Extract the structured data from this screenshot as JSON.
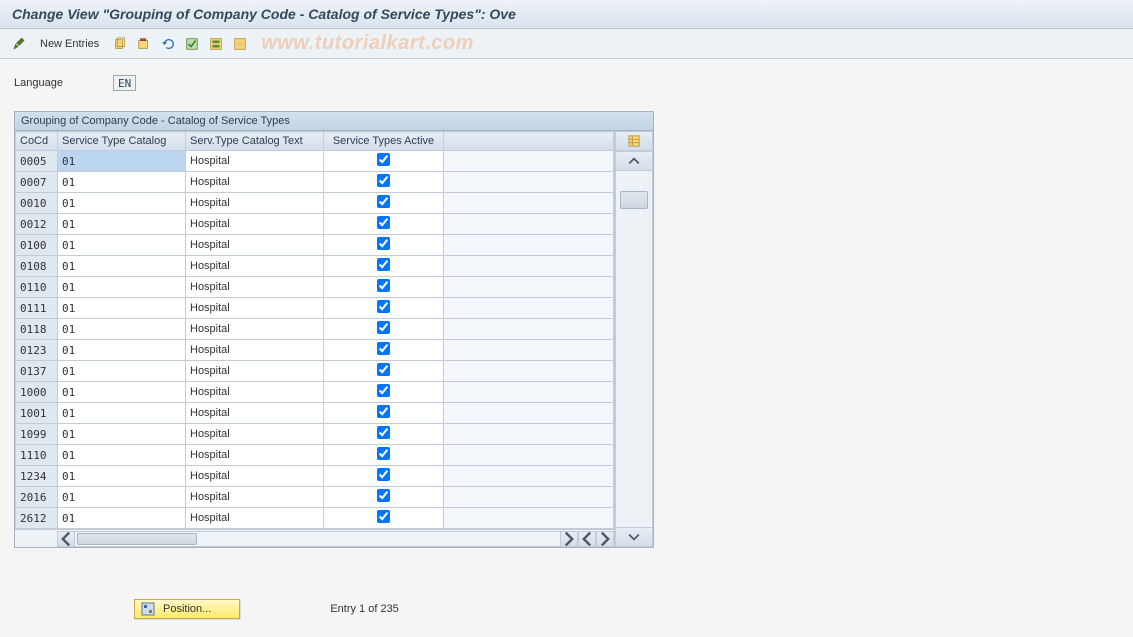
{
  "title": "Change View \"Grouping of Company Code - Catalog of Service Types\": Ove",
  "toolbar": {
    "new_entries": "New Entries"
  },
  "watermark": "www.tutorialkart.com",
  "language": {
    "label": "Language",
    "value": "EN"
  },
  "panel": {
    "title": "Grouping of Company Code - Catalog of Service Types",
    "columns": {
      "cocd": "CoCd",
      "catalog": "Service Type Catalog",
      "text": "Serv.Type Catalog Text",
      "active": "Service Types Active"
    },
    "rows": [
      {
        "cocd": "0005",
        "catalog": "01",
        "text": "Hospital",
        "active": true,
        "selected": true
      },
      {
        "cocd": "0007",
        "catalog": "01",
        "text": "Hospital",
        "active": true
      },
      {
        "cocd": "0010",
        "catalog": "01",
        "text": "Hospital",
        "active": true
      },
      {
        "cocd": "0012",
        "catalog": "01",
        "text": "Hospital",
        "active": true
      },
      {
        "cocd": "0100",
        "catalog": "01",
        "text": "Hospital",
        "active": true
      },
      {
        "cocd": "0108",
        "catalog": "01",
        "text": "Hospital",
        "active": true
      },
      {
        "cocd": "0110",
        "catalog": "01",
        "text": "Hospital",
        "active": true
      },
      {
        "cocd": "0111",
        "catalog": "01",
        "text": "Hospital",
        "active": true
      },
      {
        "cocd": "0118",
        "catalog": "01",
        "text": "Hospital",
        "active": true
      },
      {
        "cocd": "0123",
        "catalog": "01",
        "text": "Hospital",
        "active": true
      },
      {
        "cocd": "0137",
        "catalog": "01",
        "text": "Hospital",
        "active": true
      },
      {
        "cocd": "1000",
        "catalog": "01",
        "text": "Hospital",
        "active": true
      },
      {
        "cocd": "1001",
        "catalog": "01",
        "text": "Hospital",
        "active": true
      },
      {
        "cocd": "1099",
        "catalog": "01",
        "text": "Hospital",
        "active": true
      },
      {
        "cocd": "1110",
        "catalog": "01",
        "text": "Hospital",
        "active": true
      },
      {
        "cocd": "1234",
        "catalog": "01",
        "text": "Hospital",
        "active": true
      },
      {
        "cocd": "2016",
        "catalog": "01",
        "text": "Hospital",
        "active": true
      },
      {
        "cocd": "2612",
        "catalog": "01",
        "text": "Hospital",
        "active": true
      }
    ]
  },
  "footer": {
    "position": "Position...",
    "entry": "Entry 1 of 235"
  }
}
